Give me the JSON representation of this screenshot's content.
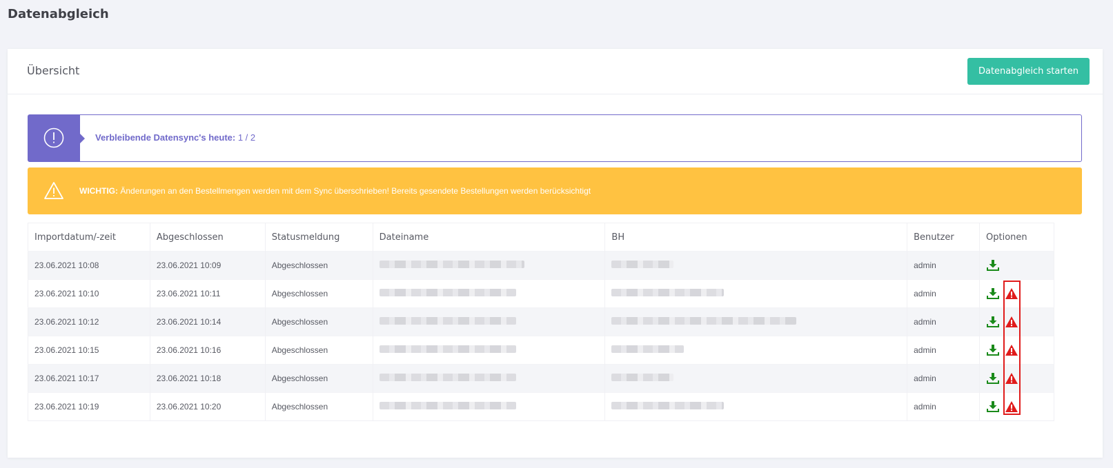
{
  "page": {
    "title": "Datenabgleich"
  },
  "card": {
    "title": "Übersicht",
    "start_button": "Datenabgleich starten"
  },
  "info": {
    "label": "Verbleibende Datensync's heute:",
    "value": "1 / 2",
    "icon": "exclamation-circle-icon",
    "color": "#716aca"
  },
  "warning": {
    "label": "WICHTIG:",
    "text": "Änderungen an den Bestellmengen werden mit dem Sync überschrieben! Bereits gesendete Bestellungen werden berücksichtigt",
    "icon": "warning-triangle-icon",
    "color": "#ffc241"
  },
  "table": {
    "columns": [
      "Importdatum/-zeit",
      "Abgeschlossen",
      "Statusmeldung",
      "Dateiname",
      "BH",
      "Benutzer",
      "Optionen"
    ],
    "rows": [
      {
        "import": "23.06.2021 10:08",
        "done": "23.06.2021 10:09",
        "status": "Abgeschlossen",
        "file": "[blurred]",
        "bh": "[blurred]",
        "user": "admin",
        "options": [
          "download-icon"
        ]
      },
      {
        "import": "23.06.2021 10:10",
        "done": "23.06.2021 10:11",
        "status": "Abgeschlossen",
        "file": "[blurred]",
        "bh": "[blurred]",
        "user": "admin",
        "options": [
          "download-icon",
          "warning-icon"
        ]
      },
      {
        "import": "23.06.2021 10:12",
        "done": "23.06.2021 10:14",
        "status": "Abgeschlossen",
        "file": "[blurred]",
        "bh": "[blurred]",
        "user": "admin",
        "options": [
          "download-icon",
          "warning-icon"
        ]
      },
      {
        "import": "23.06.2021 10:15",
        "done": "23.06.2021 10:16",
        "status": "Abgeschlossen",
        "file": "[blurred]",
        "bh": "[blurred]",
        "user": "admin",
        "options": [
          "download-icon",
          "warning-icon"
        ]
      },
      {
        "import": "23.06.2021 10:17",
        "done": "23.06.2021 10:18",
        "status": "Abgeschlossen",
        "file": "[blurred]",
        "bh": "[blurred]",
        "user": "admin",
        "options": [
          "download-icon",
          "warning-icon"
        ]
      },
      {
        "import": "23.06.2021 10:19",
        "done": "23.06.2021 10:20",
        "status": "Abgeschlossen",
        "file": "[blurred]",
        "bh": "[blurred]",
        "user": "admin",
        "options": [
          "download-icon",
          "warning-icon"
        ]
      }
    ]
  },
  "colors": {
    "accent": "#34bfa3",
    "download": "#1a8a1a",
    "error": "#e01b1b"
  }
}
